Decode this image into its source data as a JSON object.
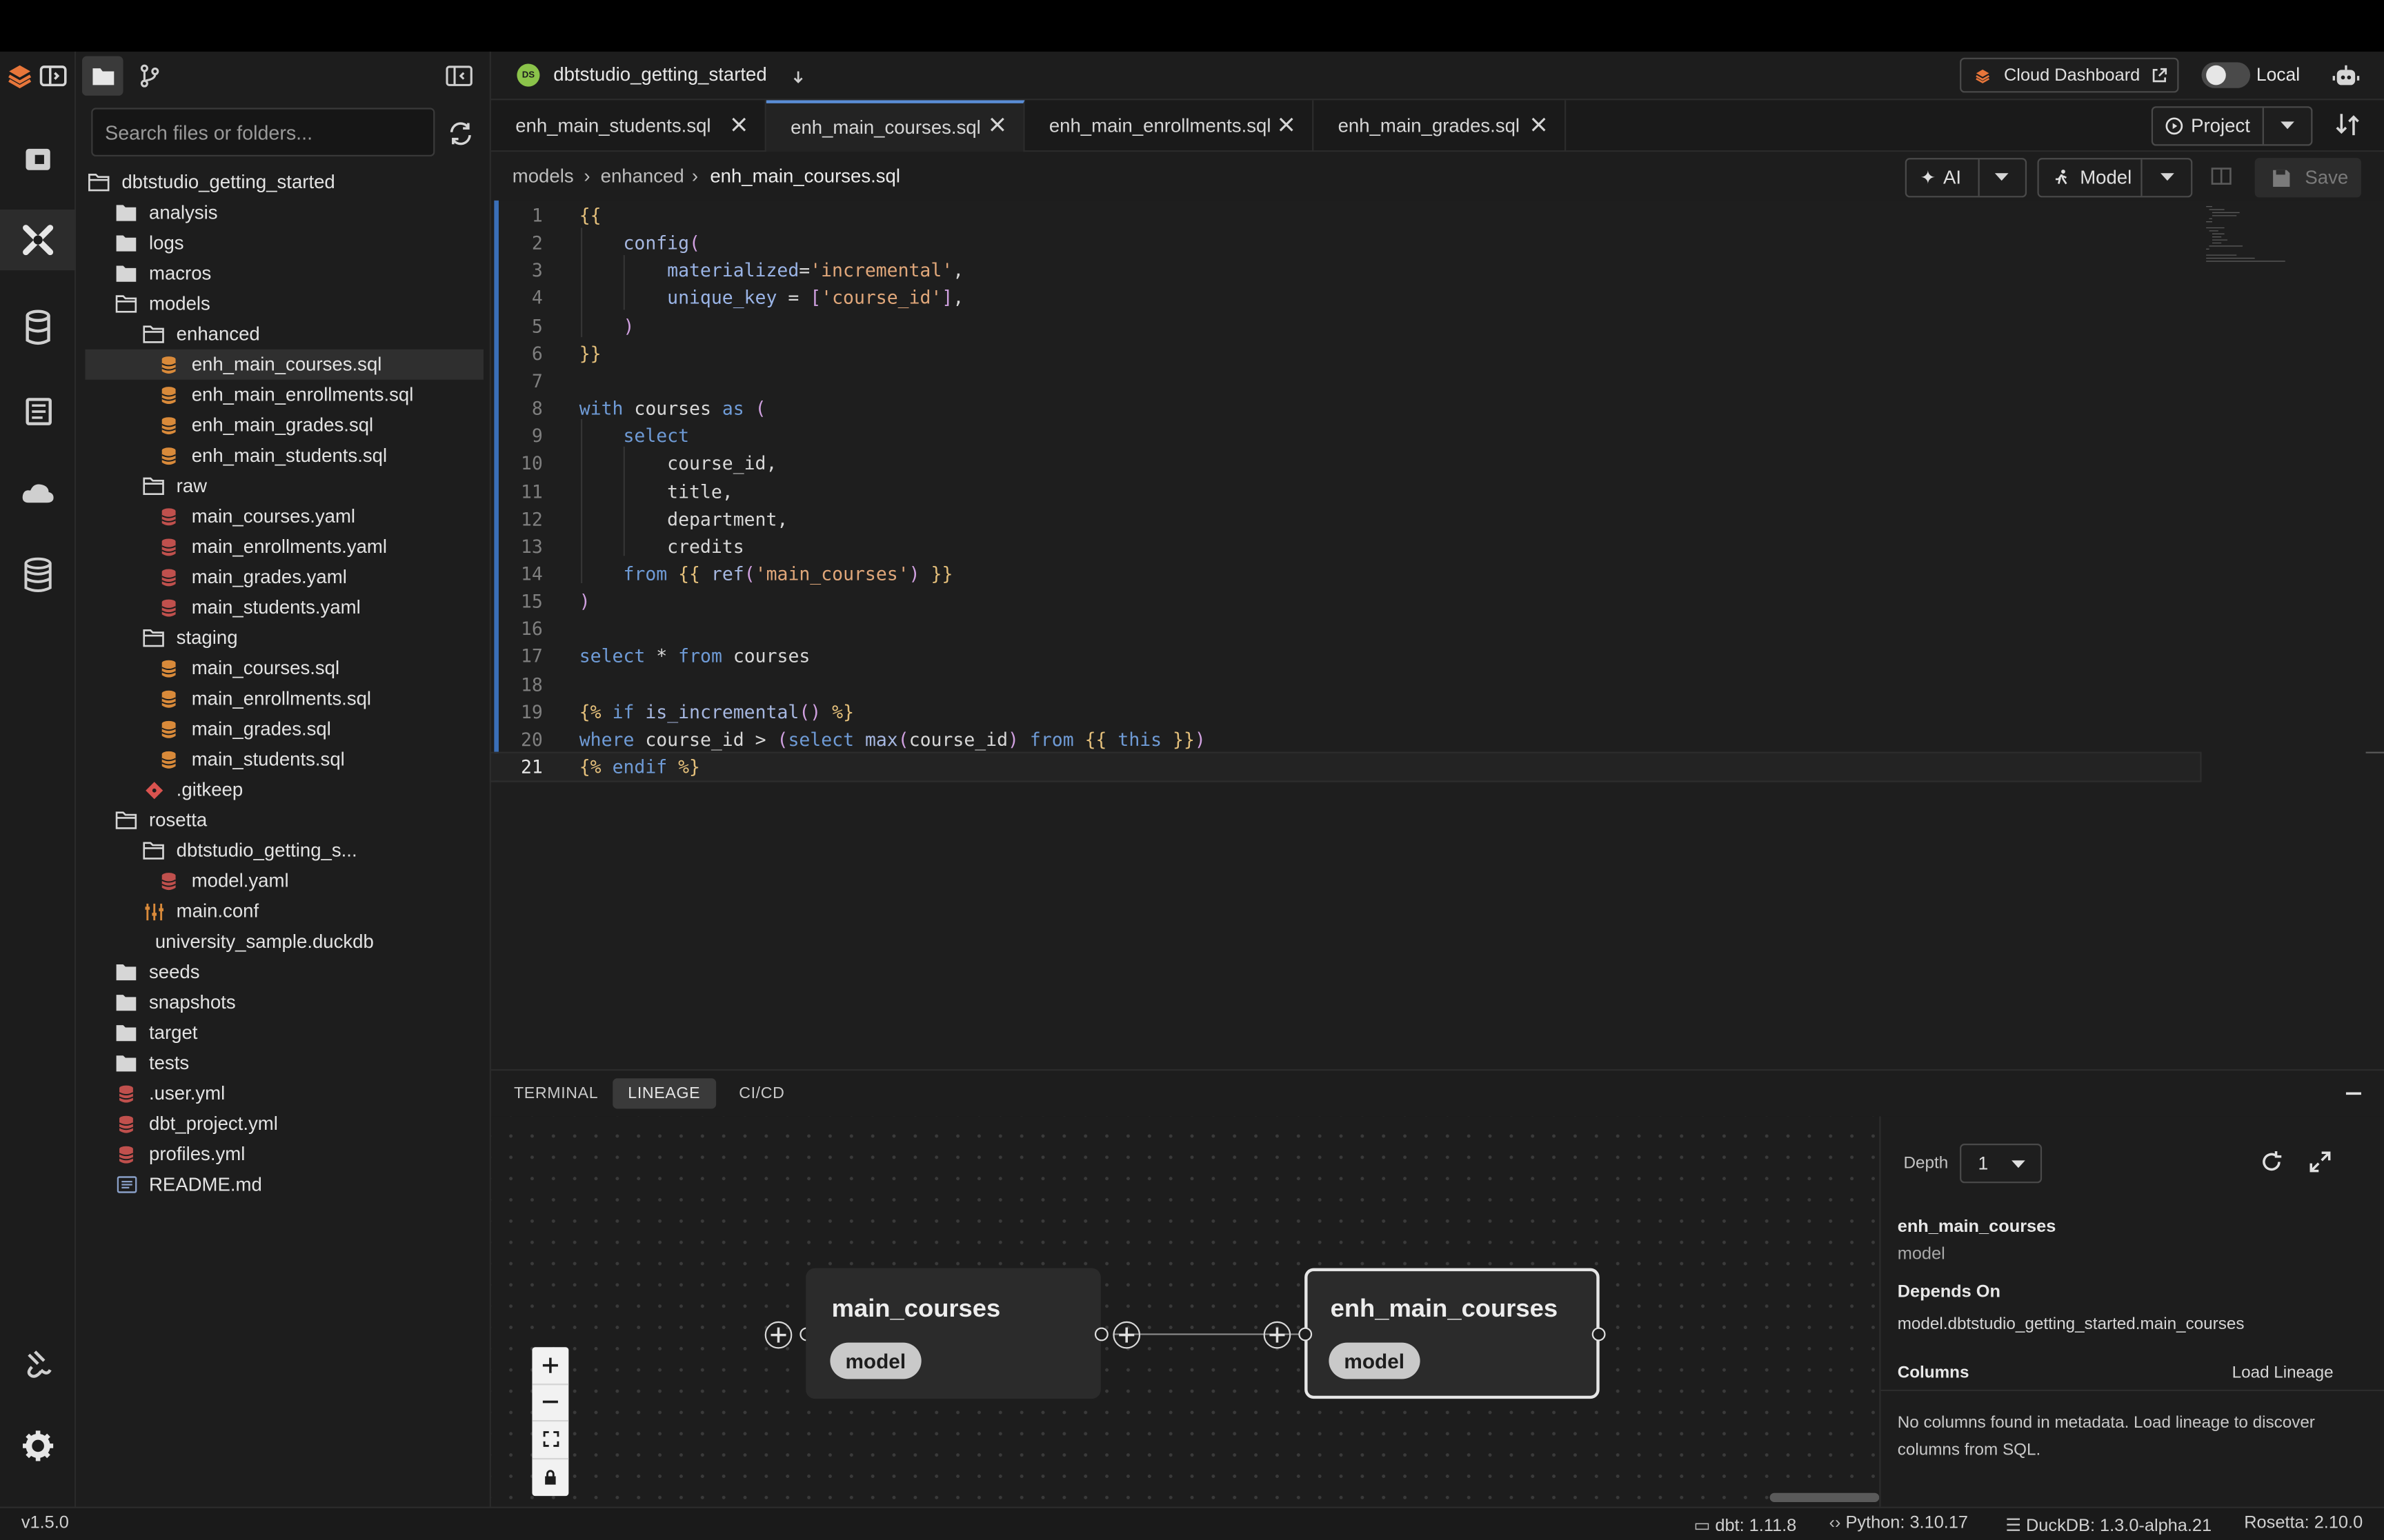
{
  "app": {
    "project_name": "dbtstudio_getting_started",
    "project_badge": "DS",
    "cloud_dashboard_label": "Cloud Dashboard",
    "local_label": "Local"
  },
  "explorer": {
    "search_placeholder": "Search files or folders...",
    "tree": [
      {
        "label": "dbtstudio_getting_started",
        "icon": "folder-open-icon",
        "depth": 0
      },
      {
        "label": "analysis",
        "icon": "folder-icon",
        "depth": 1
      },
      {
        "label": "logs",
        "icon": "folder-icon",
        "depth": 1
      },
      {
        "label": "macros",
        "icon": "folder-icon",
        "depth": 1
      },
      {
        "label": "models",
        "icon": "folder-open-icon",
        "depth": 1
      },
      {
        "label": "enhanced",
        "icon": "folder-open-icon",
        "depth": 2
      },
      {
        "label": "enh_main_courses.sql",
        "icon": "sql-file-icon",
        "depth": 3,
        "selected": true
      },
      {
        "label": "enh_main_enrollments.sql",
        "icon": "sql-file-icon",
        "depth": 3
      },
      {
        "label": "enh_main_grades.sql",
        "icon": "sql-file-icon",
        "depth": 3
      },
      {
        "label": "enh_main_students.sql",
        "icon": "sql-file-icon",
        "depth": 3
      },
      {
        "label": "raw",
        "icon": "folder-open-icon",
        "depth": 2
      },
      {
        "label": "main_courses.yaml",
        "icon": "yaml-file-icon",
        "depth": 3
      },
      {
        "label": "main_enrollments.yaml",
        "icon": "yaml-file-icon",
        "depth": 3
      },
      {
        "label": "main_grades.yaml",
        "icon": "yaml-file-icon",
        "depth": 3
      },
      {
        "label": "main_students.yaml",
        "icon": "yaml-file-icon",
        "depth": 3
      },
      {
        "label": "staging",
        "icon": "folder-open-icon",
        "depth": 2
      },
      {
        "label": "main_courses.sql",
        "icon": "sql-file-icon",
        "depth": 3
      },
      {
        "label": "main_enrollments.sql",
        "icon": "sql-file-icon",
        "depth": 3
      },
      {
        "label": "main_grades.sql",
        "icon": "sql-file-icon",
        "depth": 3
      },
      {
        "label": "main_students.sql",
        "icon": "sql-file-icon",
        "depth": 3
      },
      {
        "label": ".gitkeep",
        "icon": "git-icon",
        "depth": 2
      },
      {
        "label": "rosetta",
        "icon": "folder-open-icon",
        "depth": 1
      },
      {
        "label": "dbtstudio_getting_s...",
        "icon": "folder-open-icon",
        "depth": 2
      },
      {
        "label": "model.yaml",
        "icon": "yaml-file-icon",
        "depth": 3
      },
      {
        "label": "main.conf",
        "icon": "conf-file-icon",
        "depth": 2
      },
      {
        "label": "university_sample.duckdb",
        "icon": "none",
        "depth": 2
      },
      {
        "label": "seeds",
        "icon": "folder-icon",
        "depth": 1
      },
      {
        "label": "snapshots",
        "icon": "folder-icon",
        "depth": 1
      },
      {
        "label": "target",
        "icon": "folder-icon",
        "depth": 1
      },
      {
        "label": "tests",
        "icon": "folder-icon",
        "depth": 1
      },
      {
        "label": ".user.yml",
        "icon": "yaml-file-icon",
        "depth": 1
      },
      {
        "label": "dbt_project.yml",
        "icon": "yaml-file-icon",
        "depth": 1
      },
      {
        "label": "profiles.yml",
        "icon": "yaml-file-icon",
        "depth": 1
      },
      {
        "label": "README.md",
        "icon": "markdown-file-icon",
        "depth": 1
      }
    ]
  },
  "tabs": [
    {
      "label": "enh_main_students.sql",
      "active": false
    },
    {
      "label": "enh_main_courses.sql",
      "active": true
    },
    {
      "label": "enh_main_enrollments.sql",
      "active": false
    },
    {
      "label": "enh_main_grades.sql",
      "active": false
    }
  ],
  "toolbar": {
    "project_label": "Project",
    "ai_label": "AI",
    "model_label": "Model",
    "save_label": "Save"
  },
  "breadcrumb": {
    "part1": "models",
    "part2": "enhanced",
    "part3": "enh_main_courses.sql"
  },
  "editor": {
    "current_line": 21,
    "lines": [
      "{{",
      "    config(",
      "        materialized='incremental',",
      "        unique_key = ['course_id'],",
      "    )",
      "}}",
      "",
      "with courses as (",
      "    select",
      "        course_id,",
      "        title,",
      "        department,",
      "        credits",
      "    from {{ ref('main_courses') }}",
      ")",
      "",
      "select * from courses",
      "",
      "{% if is_incremental() %}",
      "where course_id > (select max(course_id) from {{ this }})",
      "{% endif %}"
    ]
  },
  "panel": {
    "tabs": [
      {
        "label": "TERMINAL",
        "active": false
      },
      {
        "label": "LINEAGE",
        "active": true
      },
      {
        "label": "CI/CD",
        "active": false
      }
    ],
    "lineage": {
      "nodes": [
        {
          "title": "main_courses",
          "type": "model",
          "selected": false
        },
        {
          "title": "enh_main_courses",
          "type": "model",
          "selected": true
        }
      ],
      "depth_label": "Depth",
      "depth_value": "1",
      "selected_name": "enh_main_courses",
      "selected_type": "model",
      "depends_on_label": "Depends On",
      "depends_on_value": "model.dbtstudio_getting_started.main_courses",
      "columns_label": "Columns",
      "load_lineage_label": "Load Lineage",
      "columns_message": "No columns found in metadata. Load lineage to discover columns from SQL."
    }
  },
  "status": {
    "version": "v1.5.0",
    "dbt": "dbt: 1.11.8",
    "python": "Python: 3.10.17",
    "duckdb": "DuckDB: 1.3.0-alpha.21",
    "rosetta": "Rosetta: 2.10.0"
  },
  "colors": {
    "accent_blue": "#5a8dd6",
    "brand_orange": "#e8763a",
    "project_badge_green": "#8bc34a",
    "keyword": "#6f9bd6",
    "string": "#e0a77a",
    "function": "#a6b7e0"
  }
}
